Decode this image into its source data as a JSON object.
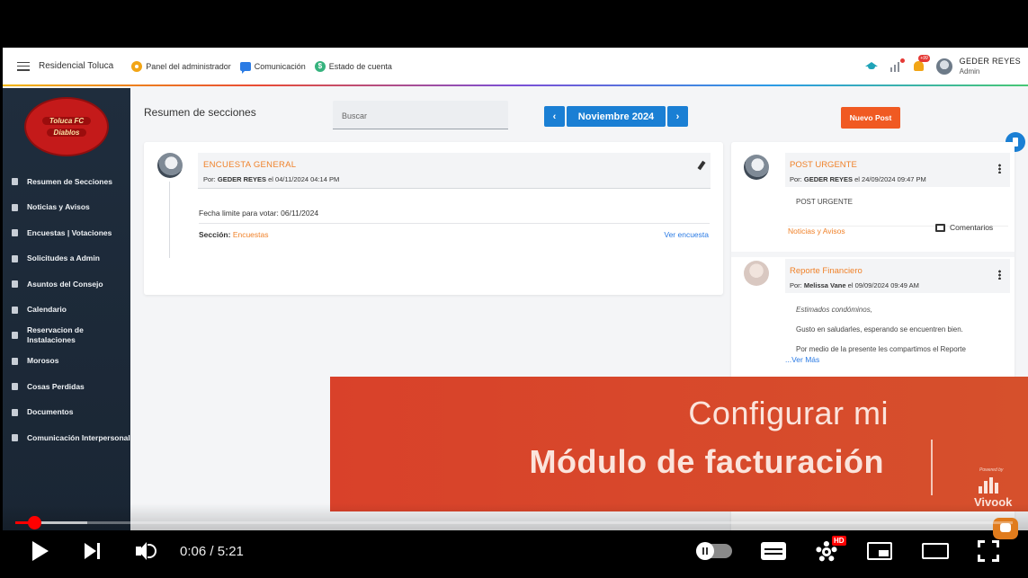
{
  "app": {
    "brand": "Residencial Toluca",
    "nav": [
      {
        "label": "Panel del administrador",
        "icon": "gear-icon"
      },
      {
        "label": "Comunicación",
        "icon": "chat-icon"
      },
      {
        "label": "Estado de cuenta",
        "icon": "dollar-icon"
      }
    ],
    "notification_badge": "+99",
    "user": {
      "name": "GEDER REYES",
      "role": "Admin"
    }
  },
  "logo": {
    "line1": "Toluca FC",
    "line2": "Diablos"
  },
  "sidebar": {
    "items": [
      {
        "label": "Resumen de Secciones"
      },
      {
        "label": "Noticias y Avisos"
      },
      {
        "label": "Encuestas | Votaciones"
      },
      {
        "label": "Solicitudes a Admin"
      },
      {
        "label": "Asuntos del Consejo"
      },
      {
        "label": "Calendario"
      },
      {
        "label": "Reservacion de Instalaciones"
      },
      {
        "label": "Morosos"
      },
      {
        "label": "Cosas Perdidas"
      },
      {
        "label": "Documentos"
      },
      {
        "label": "Comunicación Interpersonal"
      }
    ]
  },
  "main": {
    "title": "Resumen de secciones",
    "search_placeholder": "Buscar",
    "month": "Noviembre 2024",
    "prev": "‹",
    "next": "›",
    "new_post": "Nuevo Post"
  },
  "survey": {
    "title": "ENCUESTA GENERAL",
    "by_prefix": "Por:",
    "author": "GEDER REYES",
    "date": "el 04/11/2024 04:14 PM",
    "deadline": "Fecha limite para votar: 06/11/2024",
    "section_label": "Sección:",
    "section_value": "Encuestas",
    "view_link": "Ver encuesta"
  },
  "posts": [
    {
      "title": "POST URGENTE",
      "by_prefix": "Por:",
      "author": "GEDER REYES",
      "date": "el 24/09/2024 09:47 PM",
      "body": "POST URGENTE",
      "category": "Noticias y Avisos",
      "comments": "Comentarios"
    },
    {
      "title": "Reporte Financiero",
      "by_prefix": "Por:",
      "author": "Melissa Vane",
      "date": "el 09/09/2024 09:49 AM",
      "body_lines": [
        "Estimados condóminos,",
        "Gusto en saludarles, esperando se encuentren bien.",
        "Por medio de la presente les compartimos el Reporte"
      ],
      "more": "...Ver Más"
    }
  ],
  "banner": {
    "line1": "Configurar mi",
    "line2": "Módulo de facturación",
    "powered": "Powered by",
    "vivook": "Vivook"
  },
  "player": {
    "time": "0:06 / 5:21",
    "progress": 0.019,
    "hd": "HD"
  }
}
